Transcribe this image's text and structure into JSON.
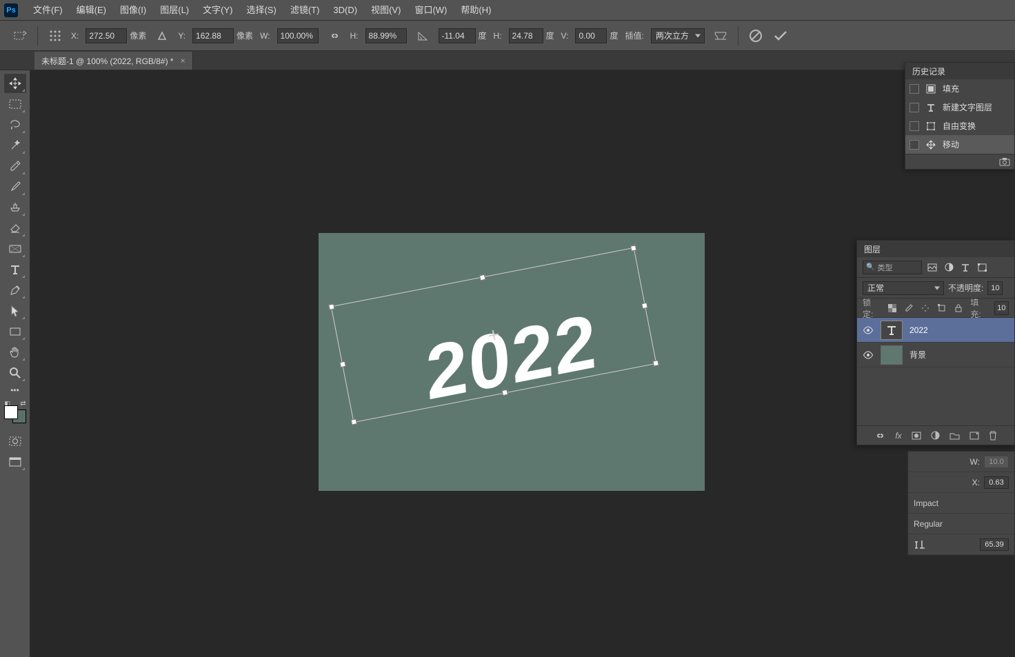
{
  "menus": [
    "文件(F)",
    "编辑(E)",
    "图像(I)",
    "图层(L)",
    "文字(Y)",
    "选择(S)",
    "滤镜(T)",
    "3D(D)",
    "视图(V)",
    "窗口(W)",
    "帮助(H)"
  ],
  "options": {
    "x_label": "X:",
    "x": "272.50",
    "x_unit": "像素",
    "y_label": "Y:",
    "y": "162.88",
    "y_unit": "像素",
    "w_label": "W:",
    "w": "100.00%",
    "h_label": "H:",
    "h": "88.99%",
    "angle": "-11.04",
    "angle_unit": "度",
    "h2_label": "H:",
    "h2": "24.78",
    "h2_unit": "度",
    "v_label": "V:",
    "v": "0.00",
    "v_unit": "度",
    "interp_label": "插值:",
    "interp_value": "两次立方"
  },
  "document_tab": "未标题-1 @ 100% (2022, RGB/8#) *",
  "canvas_text": "2022",
  "history": {
    "title": "历史记录",
    "items": [
      {
        "icon": "fill",
        "label": "填充"
      },
      {
        "icon": "type",
        "label": "新建文字图层"
      },
      {
        "icon": "free",
        "label": "自由变换"
      },
      {
        "icon": "move",
        "label": "移动"
      }
    ]
  },
  "layers": {
    "title": "图层",
    "kind_label": "类型",
    "blend_mode": "正常",
    "opacity_label": "不透明度:",
    "opacity_value": "10",
    "lock_label": "锁定:",
    "fill_label": "填充:",
    "fill_value": "10",
    "items": [
      {
        "name": "2022",
        "type": "text",
        "selected": true
      },
      {
        "name": "背景",
        "type": "bg",
        "selected": false
      }
    ]
  },
  "char": {
    "w_label": "W:",
    "w_value": "10.0",
    "x_label": "X:",
    "x_value": "0.63",
    "font": "Impact",
    "style": "Regular",
    "size_value": "65.39"
  }
}
